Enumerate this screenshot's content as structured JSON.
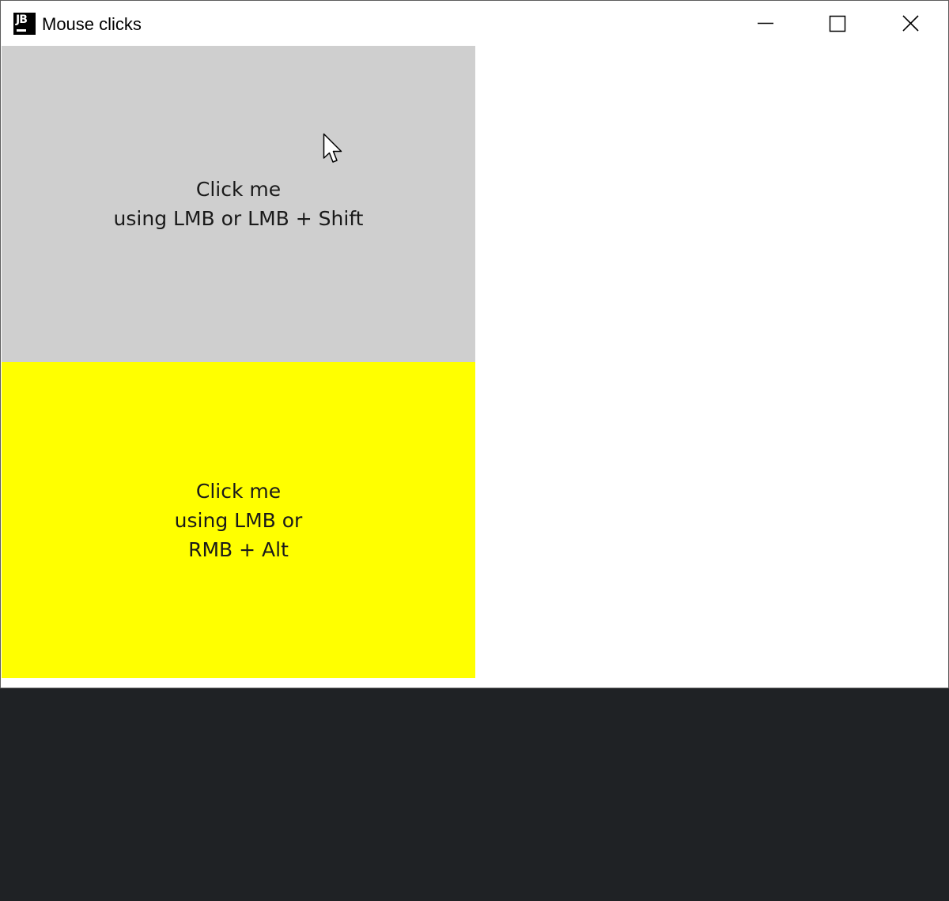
{
  "window": {
    "title": "Mouse clicks",
    "app_icon_text": "JB",
    "controls": {
      "minimize_icon": "minimize-icon",
      "maximize_icon": "maximize-icon",
      "close_icon": "close-icon"
    }
  },
  "panels": {
    "gray": {
      "color": "#cfcfcf",
      "line1": "Click me",
      "line2": "using LMB or LMB + Shift"
    },
    "yellow": {
      "color": "#ffff00",
      "line1": "Click me",
      "line2": "using LMB or",
      "line3": "RMB + Alt"
    }
  },
  "cursor": {
    "icon": "pointer-arrow-icon"
  }
}
